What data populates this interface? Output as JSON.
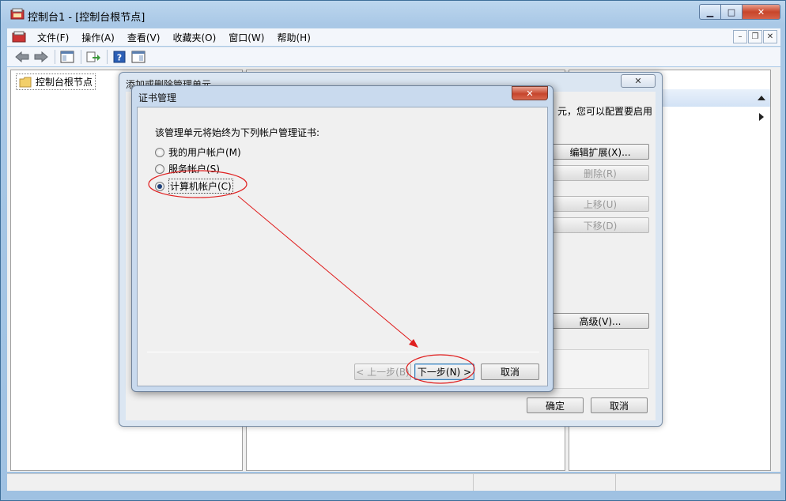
{
  "window": {
    "title": "控制台1 - [控制台根节点]",
    "minimize": "▁",
    "maximize": "□",
    "close": "✕"
  },
  "menu": {
    "items": [
      "文件(F)",
      "操作(A)",
      "查看(V)",
      "收藏夹(O)",
      "窗口(W)",
      "帮助(H)"
    ],
    "mdi_min": "–",
    "mdi_restore": "❐",
    "mdi_close": "✕"
  },
  "tree": {
    "root_label": "控制台根节点"
  },
  "add_dialog": {
    "title": "添加或删除管理单元",
    "close": "✕",
    "description": "元，您可以配置要启用",
    "edit_ext": "编辑扩展(X)...",
    "remove": "删除(R)",
    "move_up": "上移(U)",
    "move_down": "下移(D)",
    "advanced": "高级(V)...",
    "ok": "确定",
    "cancel": "取消"
  },
  "cert_dialog": {
    "title": "证书管理",
    "close": "✕",
    "prompt": "该管理单元将始终为下列帐户管理证书:",
    "options": [
      {
        "label": "我的用户帐户(M)",
        "checked": false
      },
      {
        "label": "服务帐户(S)",
        "checked": false
      },
      {
        "label": "计算机帐户(C)",
        "checked": true
      }
    ],
    "back": "< 上一步(B)",
    "next": "下一步(N) >",
    "cancel": "取消"
  },
  "colors": {
    "annotation": "#e02020",
    "title_bar": "#a9c8e6",
    "close_red": "#c6452c"
  }
}
